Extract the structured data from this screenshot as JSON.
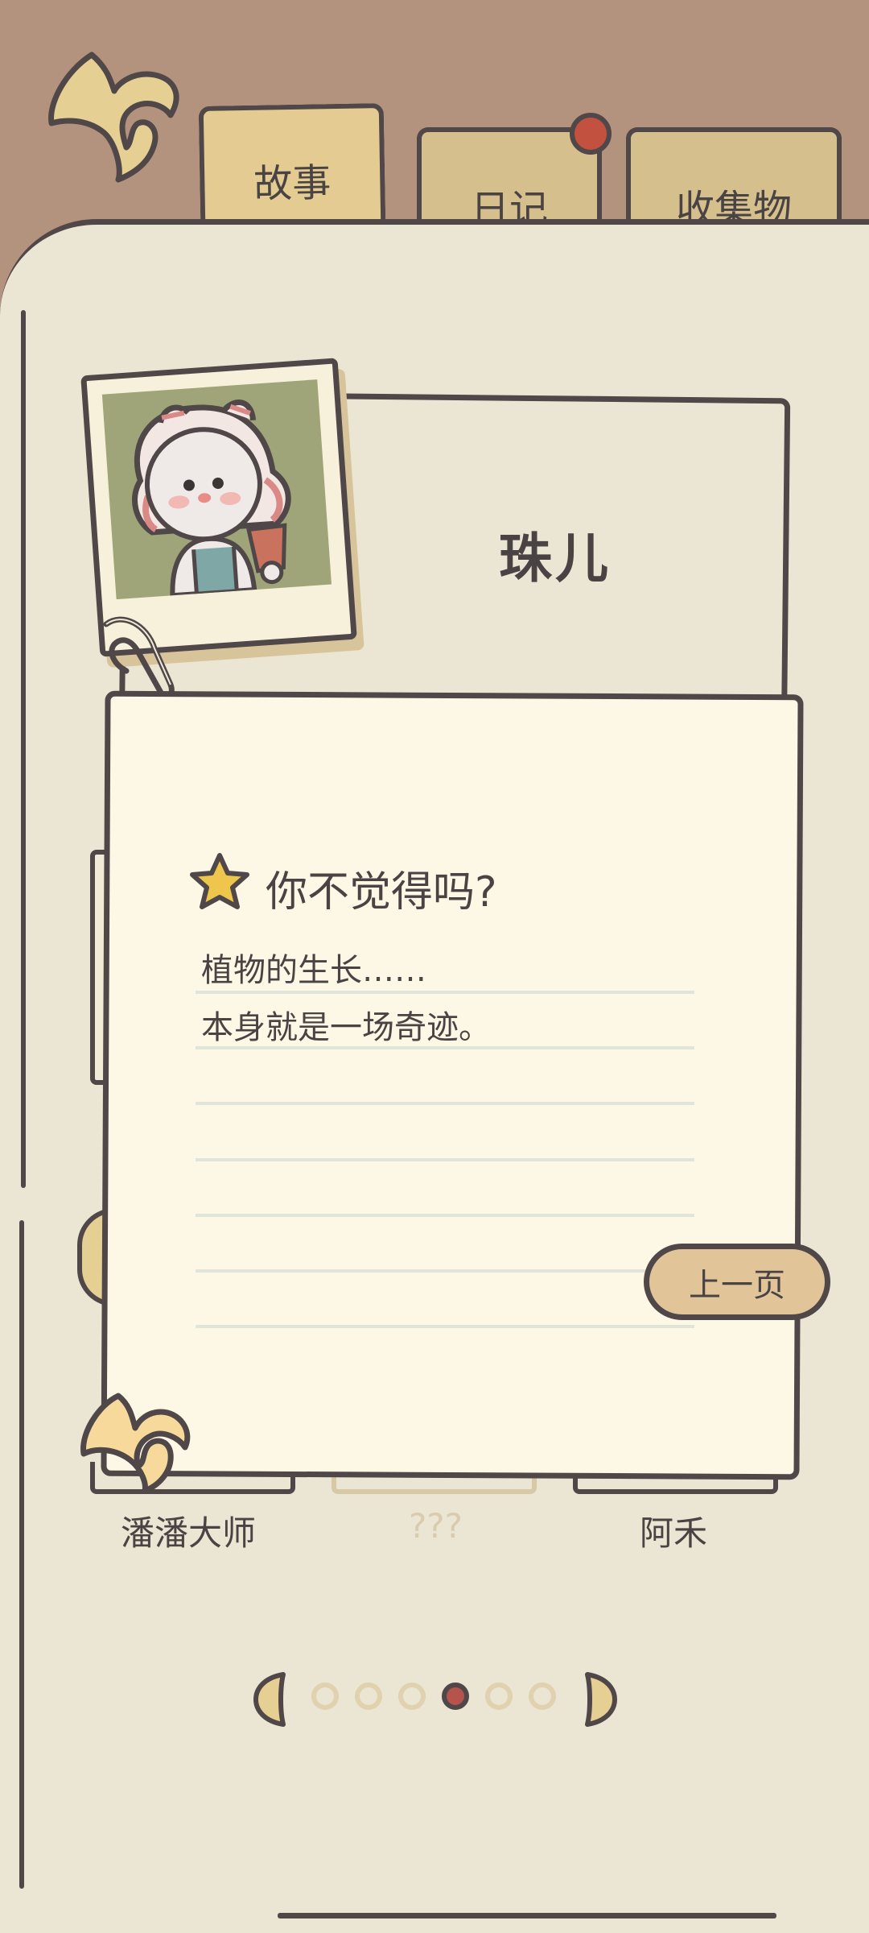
{
  "tabs": [
    {
      "label": "故事",
      "active": true
    },
    {
      "label": "日记",
      "active": false,
      "has_notification": true
    },
    {
      "label": "收集物",
      "active": false
    }
  ],
  "character": {
    "name": "珠儿"
  },
  "note": {
    "icon": "star-icon",
    "title": "你不觉得吗?",
    "lines": [
      "植物的生长……",
      "本身就是一场奇迹。"
    ],
    "prev_button": "上一页"
  },
  "characters_row": [
    "潘潘大师",
    "???",
    "阿禾"
  ],
  "pagination": {
    "total": 6,
    "current": 4
  },
  "colors": {
    "background": "#b3927e",
    "page": "#ebe5d4",
    "note": "#fdf8e5",
    "tab": "#e3cb91",
    "outline": "#4f4748",
    "accent": "#b5534c"
  }
}
